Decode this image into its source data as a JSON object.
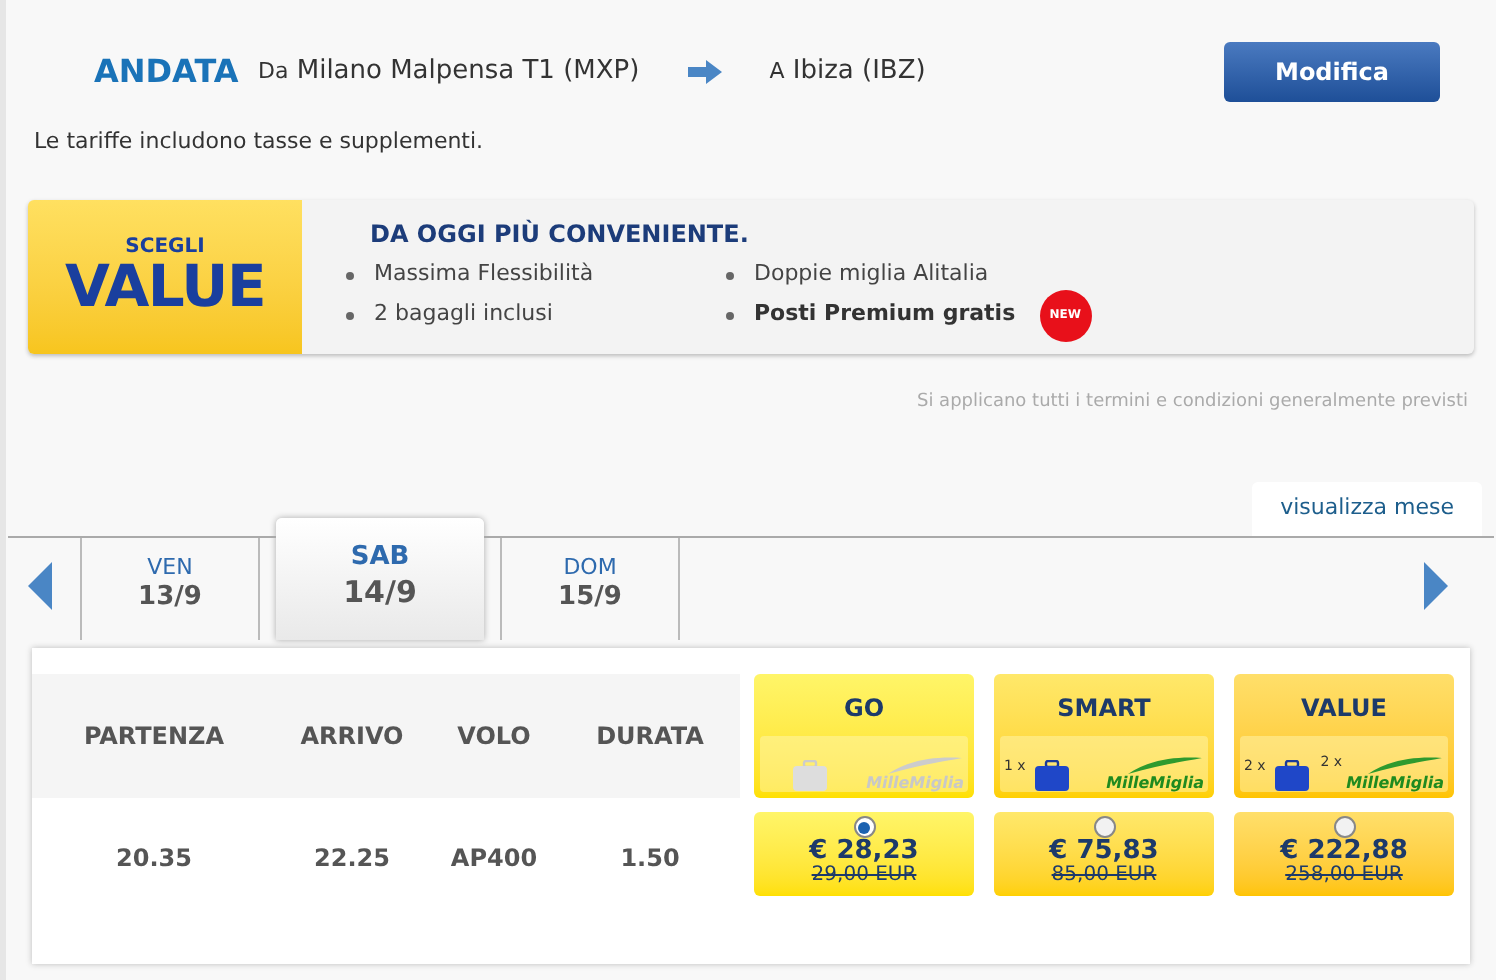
{
  "trip": {
    "label": "ANDATA",
    "from_prefix": "Da",
    "from": "Milano Malpensa T1 (MXP)",
    "to_prefix": "A",
    "to": "Ibiza (IBZ)"
  },
  "edit_button": "Modifica",
  "note": "Le tariffe includono tasse e supplementi.",
  "promo": {
    "badge_top": "SCEGLI",
    "badge_main": "VALUE",
    "title": "DA OGGI PIÙ CONVENIENTE.",
    "features": [
      {
        "text": "Massima Flessibilità",
        "bold": false
      },
      {
        "text": "2 bagagli inclusi",
        "bold": false
      },
      {
        "text": "Doppie miglia Alitalia",
        "bold": false
      },
      {
        "text": "Posti Premium gratis",
        "bold": true,
        "new_badge": "NEW"
      }
    ]
  },
  "terms": "Si applicano tutti i termini e condizioni generalmente previsti",
  "month_link": "visualizza mese",
  "days": [
    {
      "weekday": "VEN",
      "date": "13/9",
      "selected": false
    },
    {
      "weekday": "SAB",
      "date": "14/9",
      "selected": true
    },
    {
      "weekday": "DOM",
      "date": "15/9",
      "selected": false
    }
  ],
  "table": {
    "columns": [
      "PARTENZA",
      "ARRIVO",
      "VOLO",
      "DURATA"
    ],
    "rows": [
      {
        "cells": [
          "20.35",
          "22.25",
          "AP400",
          "1.50"
        ]
      }
    ]
  },
  "fares": [
    {
      "name": "GO",
      "included": false,
      "logo": "MilleMiglia",
      "price": "€ 28,23",
      "old_price": "29,00 EUR",
      "selected": true
    },
    {
      "name": "SMART",
      "included": true,
      "bag_count": "1 x",
      "logo": "MilleMiglia",
      "price": "€ 75,83",
      "old_price": "85,00 EUR",
      "selected": false
    },
    {
      "name": "VALUE",
      "included": true,
      "bag_count": "2 x",
      "miles_count": "2 x",
      "logo": "MilleMiglia",
      "price": "€ 222,88",
      "old_price": "258,00 EUR",
      "selected": false
    }
  ]
}
